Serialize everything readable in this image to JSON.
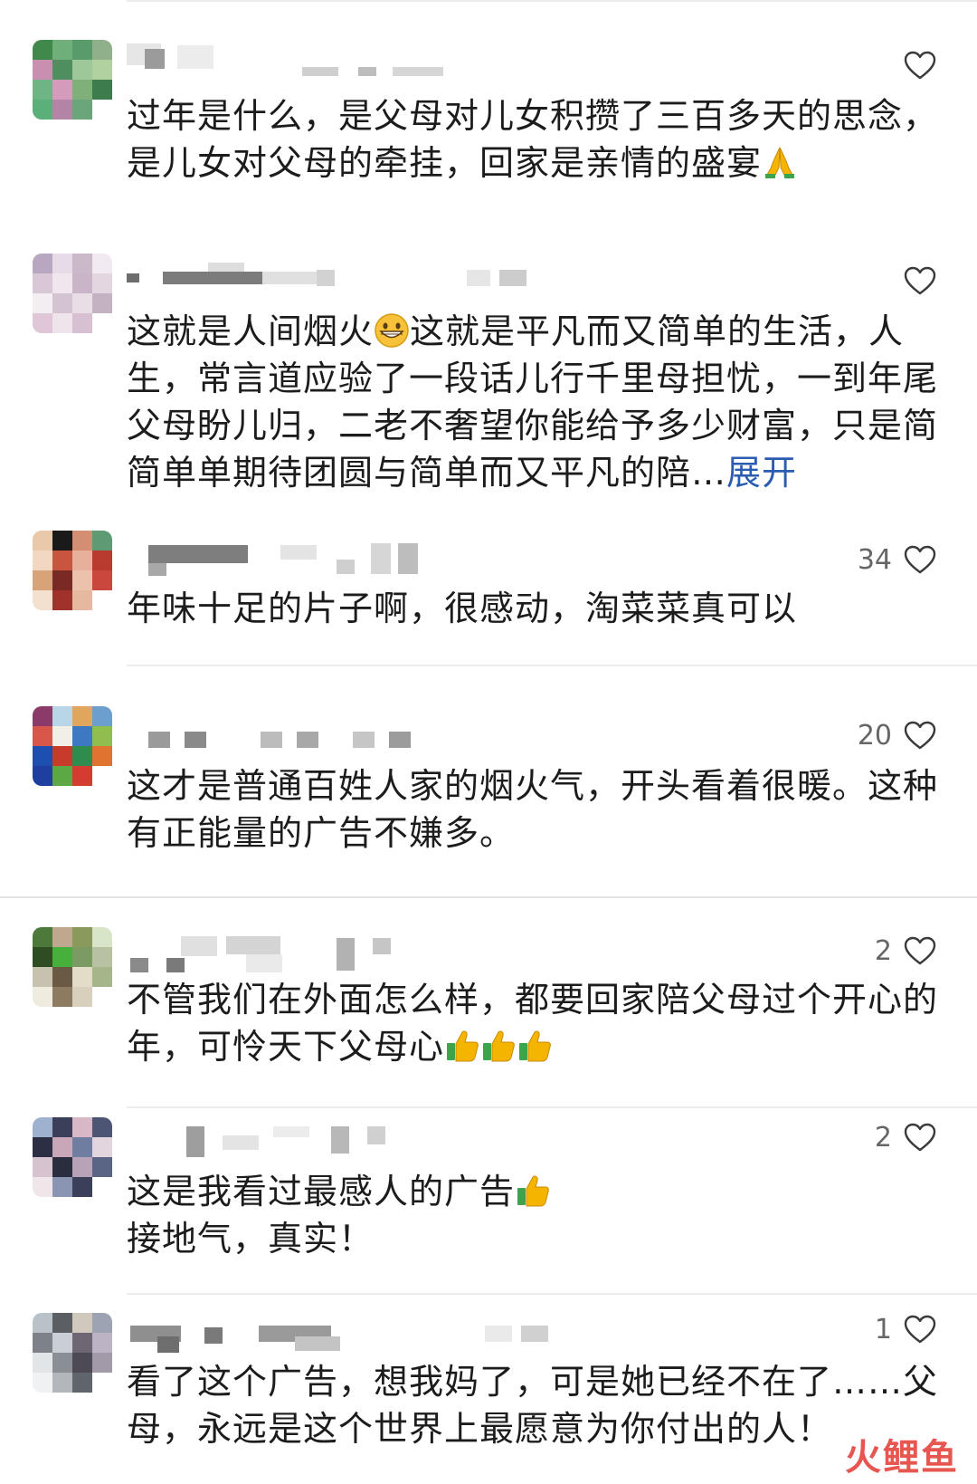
{
  "comments": [
    {
      "text": "过年是什么，是父母对儿女积攒了三百多天的思念，是儿女对父母的牵挂，回家是亲情的盛宴",
      "emoji": "praying-hands",
      "likes": ""
    },
    {
      "text": "这就是人间烟火",
      "emoji_mid": "grinning-face",
      "text_after": "这就是平凡而又简单的生活，人生，常言道应验了一段话儿行千里母担忧，一到年尾父母盼儿归，二老不奢望你能给予多少财富，只是简简单单期待团圆与简单而又平凡的陪…",
      "expand_label": "展开",
      "likes": ""
    },
    {
      "text": "年味十足的片子啊，很感动，淘菜菜真可以",
      "likes": "34"
    },
    {
      "text": "这才是普通百姓人家的烟火气，开头看着很暖。这种有正能量的广告不嫌多。",
      "likes": "20"
    },
    {
      "text": "不管我们在外面怎么样，都要回家陪父母过个开心的年，可怜天下父母心",
      "emoji": "thumbs-up x3",
      "likes": "2"
    },
    {
      "text": "这是我看过最感人的广告",
      "emoji": "thumbs-up",
      "text_line2": "接地气，真实！",
      "likes": "2"
    },
    {
      "text": "看了这个广告，想我妈了，可是她已经不在了……父母，永远是这个世界上最愿意为你付出的人！",
      "likes": "1"
    }
  ],
  "watermark": "火鲤鱼",
  "colors": {
    "link": "#2a5db0",
    "text": "#1c1c1c",
    "count": "#666666",
    "watermark": "#e53935"
  }
}
